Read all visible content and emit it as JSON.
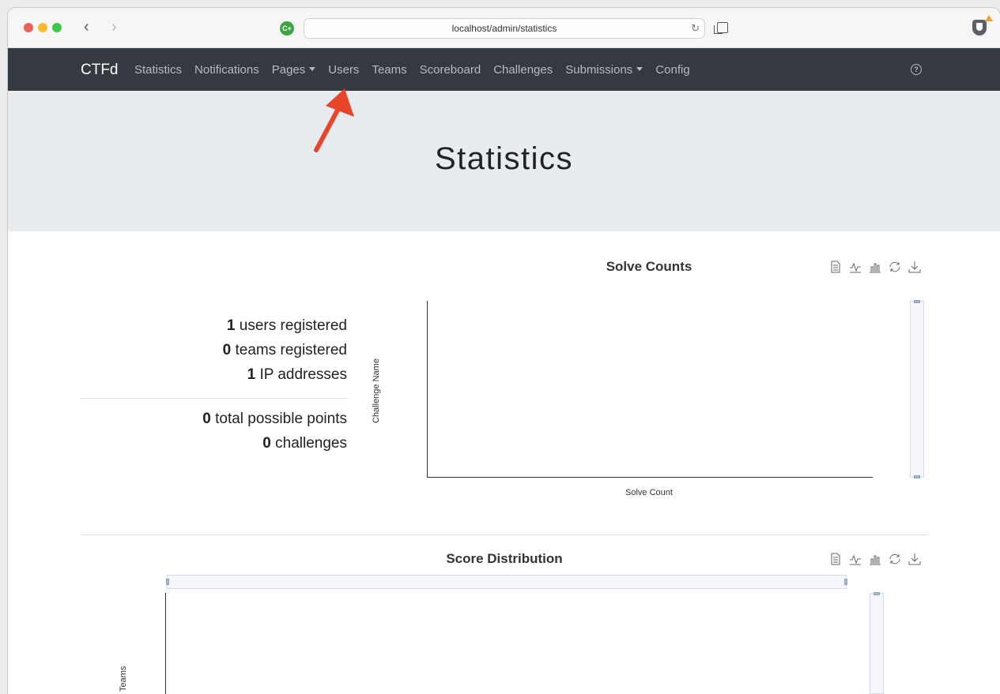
{
  "browser": {
    "url": "localhost/admin/statistics",
    "site_icon_label": "C+"
  },
  "navbar": {
    "brand": "CTFd",
    "items": [
      {
        "label": "Statistics",
        "dropdown": false
      },
      {
        "label": "Notifications",
        "dropdown": false
      },
      {
        "label": "Pages",
        "dropdown": true
      },
      {
        "label": "Users",
        "dropdown": false
      },
      {
        "label": "Teams",
        "dropdown": false
      },
      {
        "label": "Scoreboard",
        "dropdown": false
      },
      {
        "label": "Challenges",
        "dropdown": false
      },
      {
        "label": "Submissions",
        "dropdown": true
      },
      {
        "label": "Config",
        "dropdown": false
      }
    ],
    "help_icon": "?"
  },
  "page": {
    "title": "Statistics"
  },
  "stats": {
    "users_count": "1",
    "users_label": " users registered",
    "teams_count": "0",
    "teams_label": " teams registered",
    "ips_count": "1",
    "ips_label": " IP addresses",
    "points_count": "0",
    "points_label": " total possible points",
    "challenges_count": "0",
    "challenges_label": " challenges"
  },
  "colors": {
    "navbar_bg": "#343a40",
    "jumbotron_bg": "#e9ecef",
    "annotation_arrow": "#e8462b"
  },
  "chart_data": [
    {
      "type": "bar",
      "title": "Solve Counts",
      "xlabel": "Solve Count",
      "ylabel": "Challenge Name",
      "categories": [],
      "values": [],
      "toolbox": [
        "data-view-icon",
        "line-chart-icon",
        "bar-chart-icon",
        "restore-icon",
        "download-icon"
      ]
    },
    {
      "type": "bar",
      "title": "Score Distribution",
      "xlabel": "",
      "ylabel": "Teams",
      "categories": [],
      "values": [],
      "toolbox": [
        "data-view-icon",
        "line-chart-icon",
        "bar-chart-icon",
        "restore-icon",
        "download-icon"
      ]
    }
  ]
}
